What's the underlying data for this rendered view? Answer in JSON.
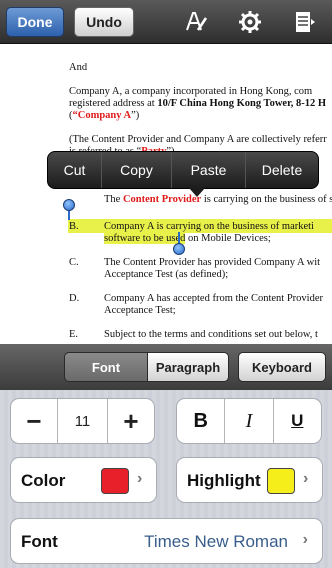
{
  "toolbar": {
    "done_label": "Done",
    "undo_label": "Undo",
    "icons": [
      "text-format-icon",
      "gear-icon",
      "document-menu-icon"
    ]
  },
  "document": {
    "lines": [
      "And",
      "Company A, a company incorporated in Hong Kong, com",
      "registered address at",
      "10/F China Hong Kong Tower, 8-12 H",
      "(",
      "“Company A",
      "”)",
      "(The Content Provider and Company A are collectively referr",
      "is referred to as “",
      "Party",
      "”)",
      "B.",
      "The",
      "Content Provider",
      "is carrying on the business of s",
      "Company A is carrying on the business of marketi",
      "software to be used",
      "on Mobile Devices;",
      "C.",
      "The Content Provider has provided Company A wit",
      "Acceptance Test (as defined);",
      "D.",
      "Company A has accepted from the Content Provider",
      "Acceptance Test;",
      "E.",
      "Subject to the terms and conditions set out below, t",
      "B.",
      "A."
    ]
  },
  "context_menu": {
    "items": [
      "Cut",
      "Copy",
      "Paste",
      "Delete"
    ]
  },
  "tabs": {
    "font": "Font",
    "paragraph": "Paragraph",
    "keyboard": "Keyboard"
  },
  "format": {
    "minus": "−",
    "size": "11",
    "plus": "+",
    "bold": "B",
    "italic": "I",
    "underline": "U",
    "color_label": "Color",
    "color_value": "#e8202a",
    "highlight_label": "Highlight",
    "highlight_value": "#f5ee1a",
    "font_label": "Font",
    "font_value": "Times New Roman",
    "chevron": "›"
  }
}
